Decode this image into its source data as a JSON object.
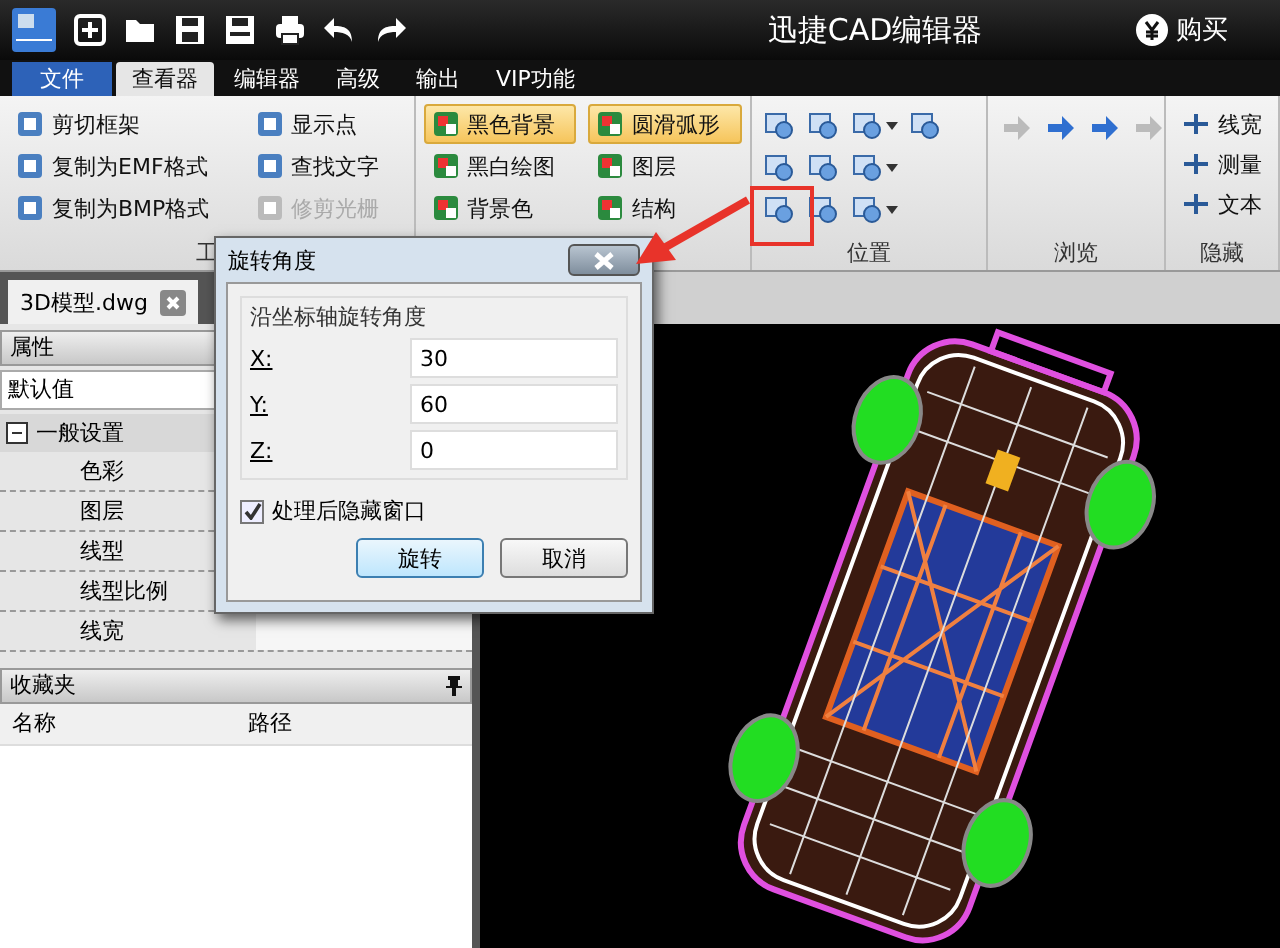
{
  "title_bar": {
    "app_title": "迅捷CAD编辑器",
    "buy_label": "购买"
  },
  "menu_tabs": [
    {
      "label": "文件",
      "kind": "file",
      "selected": false
    },
    {
      "label": "查看器",
      "kind": "tab",
      "selected": true
    },
    {
      "label": "编辑器",
      "kind": "tab",
      "selected": false
    },
    {
      "label": "高级",
      "kind": "tab",
      "selected": false
    },
    {
      "label": "输出",
      "kind": "tab",
      "selected": false
    },
    {
      "label": "VIP功能",
      "kind": "tab",
      "selected": false
    }
  ],
  "ribbon": {
    "tools_group": {
      "label": "工",
      "items": [
        {
          "label": "剪切框架",
          "disabled": false
        },
        {
          "label": "复制为EMF格式",
          "disabled": false
        },
        {
          "label": "复制为BMP格式",
          "disabled": false
        },
        {
          "label": "显示点",
          "disabled": false
        },
        {
          "label": "查找文字",
          "disabled": false
        },
        {
          "label": "修剪光栅",
          "disabled": true
        }
      ]
    },
    "display_group": {
      "items": [
        {
          "label": "黑色背景",
          "on": true
        },
        {
          "label": "黑白绘图",
          "on": false
        },
        {
          "label": "背景色",
          "on": false
        },
        {
          "label": "圆滑弧形",
          "on": true
        },
        {
          "label": "图层",
          "on": false
        },
        {
          "label": "结构",
          "on": false
        }
      ]
    },
    "position_group": {
      "label": "位置",
      "rows": [
        [
          {
            "dropdown": false
          },
          {
            "dropdown": false
          },
          {
            "dropdown": true
          },
          {
            "dropdown": false
          }
        ],
        [
          {
            "dropdown": false
          },
          {
            "dropdown": false
          },
          {
            "dropdown": true
          }
        ],
        [
          {
            "dropdown": false
          },
          {
            "dropdown": false
          },
          {
            "dropdown": true
          }
        ]
      ]
    },
    "browse_group": {
      "label": "浏览",
      "buttons": [
        {
          "disabled": true
        },
        {
          "disabled": false
        },
        {
          "disabled": false
        },
        {
          "disabled": true
        }
      ]
    },
    "hide_group": {
      "label": "隐藏",
      "items": [
        {
          "label": "线宽"
        },
        {
          "label": "测量"
        },
        {
          "label": "文本"
        }
      ]
    }
  },
  "document_tab": {
    "label": "3D模型.dwg"
  },
  "properties": {
    "title": "属性",
    "preset": "默认值",
    "section": {
      "label": "一般设置",
      "expanded": true,
      "rows": [
        "色彩",
        "图层",
        "线型",
        "线型比例",
        "线宽"
      ]
    }
  },
  "favorites": {
    "title": "收藏夹",
    "columns": [
      "名称",
      "路径"
    ]
  },
  "dialog": {
    "title": "旋转角度",
    "group_label": "沿坐标轴旋转角度",
    "fields": [
      {
        "label": "X:",
        "value": "30"
      },
      {
        "label": "Y:",
        "value": "60"
      },
      {
        "label": "Z:",
        "value": "0"
      }
    ],
    "checkbox": {
      "label": "处理后隐藏窗口",
      "checked": true
    },
    "buttons": [
      {
        "label": "旋转",
        "default": true
      },
      {
        "label": "取消",
        "default": false
      }
    ]
  }
}
